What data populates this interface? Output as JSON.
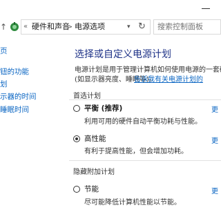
{
  "address_bar": {
    "nav_up": "↑",
    "chevron": "«",
    "crumbs": [
      "硬件和声音",
      "电源选项"
    ],
    "separator": ">",
    "refresh": "↻",
    "search_placeholder": "搜索控制面板"
  },
  "left_nav": {
    "items": [
      "页",
      "钮的功能",
      "划",
      "示器的时间",
      "睡眠时间"
    ]
  },
  "main": {
    "title": "选择或自定义电源计划",
    "description_line1": "电源计划是用于管理计算机如何使用电源的一套硬",
    "description_line2": "(如显示器亮度、睡眠等)。",
    "description_link": "告诉我有关电源计划的",
    "sections": [
      {
        "label": "首选计划",
        "plans": [
          {
            "name": "平衡 (推荐)",
            "desc": "利用可用的硬件自动平衡功耗与性能。",
            "selected": false,
            "bold": true,
            "change": "更"
          },
          {
            "name": "高性能",
            "desc": "有利于提高性能，但会增加功耗。",
            "selected": true,
            "bold": false,
            "change": "更"
          }
        ]
      },
      {
        "label": "隐藏附加计划",
        "plans": [
          {
            "name": "节能",
            "desc": "尽可能降低计算机性能以节能。",
            "selected": false,
            "bold": false,
            "change": "更"
          }
        ]
      }
    ]
  },
  "colors": {
    "title": "#1e3287",
    "link": "#0b66c3",
    "text": "#1a1a1a"
  }
}
